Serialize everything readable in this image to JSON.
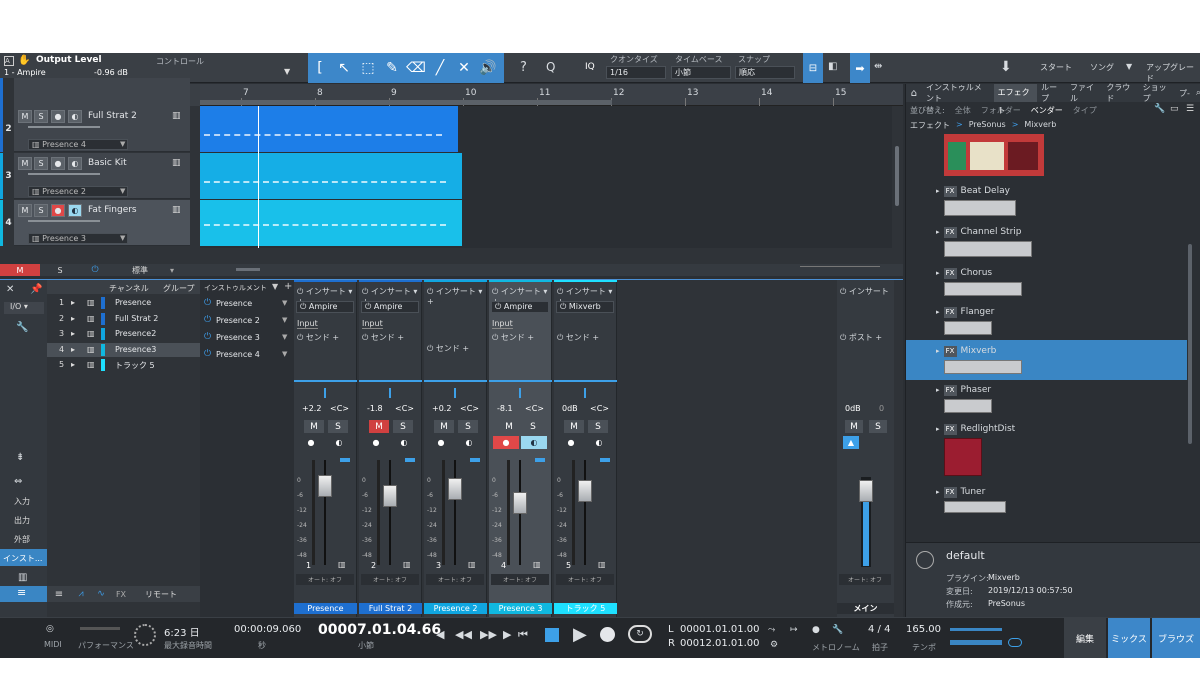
{
  "titlebar": {
    "param_name": "Output Level",
    "track_name": "1 - Ampire",
    "param_value": "-0.96 dB",
    "control_label": "コントロール"
  },
  "quantize": {
    "label": "クオンタイズ",
    "value": "1/16"
  },
  "timebase": {
    "label": "タイムベース",
    "value": "小節"
  },
  "snap": {
    "label": "スナップ",
    "value": "順応"
  },
  "iq": "IQ",
  "nav": {
    "start": "スタート",
    "song": "ソング",
    "update": "アップグレード"
  },
  "ruler": [
    "7",
    "8",
    "9",
    "10",
    "11",
    "12",
    "13",
    "14",
    "15"
  ],
  "tracks": [
    {
      "num": "",
      "name": "",
      "preset": "Presence",
      "color": "#1e6fd0",
      "clip": "#1d7ee8"
    },
    {
      "num": "2",
      "name": "Full Strat 2",
      "preset": "Presence 4",
      "color": "#1e6fd0",
      "clip": "#1d7ee8"
    },
    {
      "num": "3",
      "name": "Basic Kit",
      "preset": "Presence 2",
      "color": "#10a6e0",
      "clip": "#15aee6"
    },
    {
      "num": "4",
      "name": "Fat Fingers",
      "preset": "Presence 3",
      "color": "#10b8e0",
      "clip": "#19c0ea"
    }
  ],
  "track_btns": {
    "m": "M",
    "s": "S"
  },
  "arrange_footer": {
    "m": "M",
    "s": "S",
    "std": "標準"
  },
  "mixer_left": {
    "channel_tab": "チャンネル",
    "group_tab": "グループ",
    "io": "I/O",
    "input": "入力",
    "output": "出力",
    "external": "外部",
    "instrument": "インスト...",
    "fx": "FX",
    "remote": "リモート"
  },
  "channels": [
    {
      "n": "1",
      "name": "Presence",
      "color": "#1e6fd0"
    },
    {
      "n": "2",
      "name": "Full Strat 2",
      "color": "#1e6fd0"
    },
    {
      "n": "3",
      "name": "Presence2",
      "color": "#10a6e0"
    },
    {
      "n": "4",
      "name": "Presence3",
      "color": "#10b8e0"
    },
    {
      "n": "5",
      "name": "トラック 5",
      "color": "#1ee0ff"
    }
  ],
  "inst_panel": {
    "title": "インストゥルメント",
    "items": [
      "Presence",
      "Presence 2",
      "Presence 3",
      "Presence 4"
    ]
  },
  "strips": [
    {
      "num": "1",
      "insert": "インサート",
      "plugin": "Ampire",
      "input": "Input",
      "send": "センド",
      "vol": "+2.2",
      "pan": "<C>",
      "name": "Presence",
      "namecolor": "#1e6fd0",
      "mute_on": false,
      "rec_on": false,
      "auto": "オート: オフ"
    },
    {
      "num": "2",
      "insert": "インサート",
      "plugin": "Ampire",
      "input": "Input",
      "send": "センド",
      "vol": "-1.8",
      "pan": "<C>",
      "name": "Full Strat 2",
      "namecolor": "#1e6fd0",
      "mute_on": true,
      "rec_on": false,
      "auto": "オート: オフ"
    },
    {
      "num": "3",
      "insert": "インサート",
      "plugin": "",
      "input": "",
      "send": "センド",
      "vol": "+0.2",
      "pan": "<C>",
      "name": "Presence 2",
      "namecolor": "#10a6e0",
      "mute_on": false,
      "rec_on": false,
      "auto": "オート: オフ"
    },
    {
      "num": "4",
      "insert": "インサート",
      "plugin": "Ampire",
      "input": "Input",
      "send": "センド",
      "vol": "-8.1",
      "pan": "<C>",
      "name": "Presence 3",
      "namecolor": "#10b8e0",
      "mute_on": false,
      "rec_on": true,
      "auto": "オート: オフ"
    },
    {
      "num": "5",
      "insert": "インサート",
      "plugin": "Mixverb",
      "input": "",
      "send": "センド",
      "vol": "0dB",
      "pan": "<C>",
      "name": "トラック 5",
      "namecolor": "#1ee0ff",
      "mute_on": false,
      "rec_on": false,
      "auto": "オート: オフ"
    }
  ],
  "meter_scale": [
    "0",
    "-6",
    "-12",
    "-24",
    "-36",
    "-48"
  ],
  "main_strip": {
    "insert": "インサート",
    "post": "ポスト",
    "vol": "0dB",
    "pan": "0",
    "name": "メイン",
    "auto": "オート: オフ"
  },
  "mute_label": "M",
  "solo_label": "S",
  "browser": {
    "tabs": [
      "インストゥルメント",
      "エフェクト",
      "ループ",
      "ファイル",
      "クラウド",
      "ショップ",
      "プ-"
    ],
    "sort_label": "並び替え:",
    "sort_opts": [
      "全体",
      "フォルダー",
      "ベンダー",
      "タイプ"
    ],
    "path": [
      "エフェクト",
      "PreSonus",
      "Mixverb"
    ],
    "items": [
      "Beat Delay",
      "Channel Strip",
      "Chorus",
      "Flanger",
      "Mixverb",
      "Phaser",
      "RedlightDist",
      "Tuner"
    ],
    "selected": "Mixverb",
    "preset": "default",
    "info": [
      {
        "k": "プラグイン:",
        "v": "Mixverb"
      },
      {
        "k": "変更日:",
        "v": "2019/12/13 00:57:50"
      },
      {
        "k": "作成元:",
        "v": "PreSonus"
      }
    ]
  },
  "transport": {
    "midi": "MIDI",
    "perf": "パフォーマンス",
    "time": "6:23 日",
    "time_label": "最大録音時間",
    "seconds": "00:00:09.060",
    "sec_label": "秒",
    "bars": "00007.01.04.66",
    "bars_label": "小節",
    "loop_l": "00001.01.01.00",
    "loop_r": "00012.01.01.00",
    "l": "L",
    "r": "R",
    "metro": "メトロノーム",
    "sig": "4 / 4",
    "sig_label": "拍子",
    "tempo": "165.00",
    "tempo_label": "テンポ",
    "edit": "編集",
    "mix": "ミックス",
    "browse": "ブラウズ"
  },
  "colors": {
    "accent": "#3d87c9",
    "record": "#e04848",
    "mute": "#d04040",
    "selected": "#3a86c4"
  }
}
